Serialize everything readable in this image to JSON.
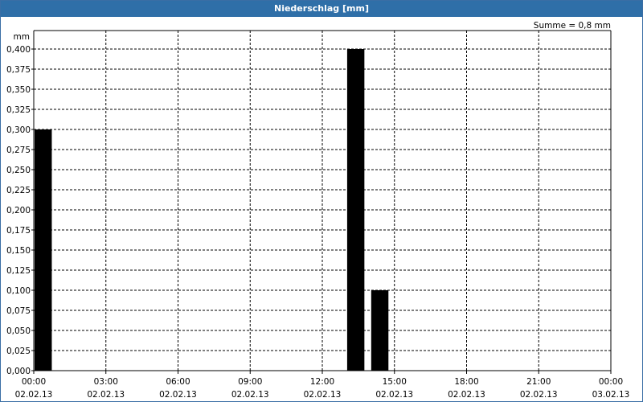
{
  "window": {
    "title": "Niederschlag [mm]"
  },
  "chart_data": {
    "type": "bar",
    "title": "Niederschlag [mm]",
    "ylabel": "mm",
    "summary": "Summe = 0,8 mm",
    "ylim": [
      0,
      0.4
    ],
    "y_ticks": [
      "0,000",
      "0,025",
      "0,050",
      "0,075",
      "0,100",
      "0,125",
      "0,150",
      "0,175",
      "0,200",
      "0,225",
      "0,250",
      "0,275",
      "0,300",
      "0,325",
      "0,350",
      "0,375",
      "0,400"
    ],
    "x_range_hours": [
      0,
      24
    ],
    "x_ticks": [
      {
        "time": "00:00",
        "date": "02.02.13"
      },
      {
        "time": "03:00",
        "date": "02.02.13"
      },
      {
        "time": "06:00",
        "date": "02.02.13"
      },
      {
        "time": "09:00",
        "date": "02.02.13"
      },
      {
        "time": "12:00",
        "date": "02.02.13"
      },
      {
        "time": "15:00",
        "date": "02.02.13"
      },
      {
        "time": "18:00",
        "date": "02.02.13"
      },
      {
        "time": "21:00",
        "date": "02.02.13"
      },
      {
        "time": "00:00",
        "date": "03.02.13"
      }
    ],
    "bars": [
      {
        "start": "02.02.13 00:00",
        "end": "02.02.13 00:45",
        "value": 0.3
      },
      {
        "start": "02.02.13 13:00",
        "end": "02.02.13 13:45",
        "value": 0.4
      },
      {
        "start": "02.02.13 14:00",
        "end": "02.02.13 14:45",
        "value": 0.1
      }
    ],
    "bar_color": "#000000",
    "grid": true
  }
}
